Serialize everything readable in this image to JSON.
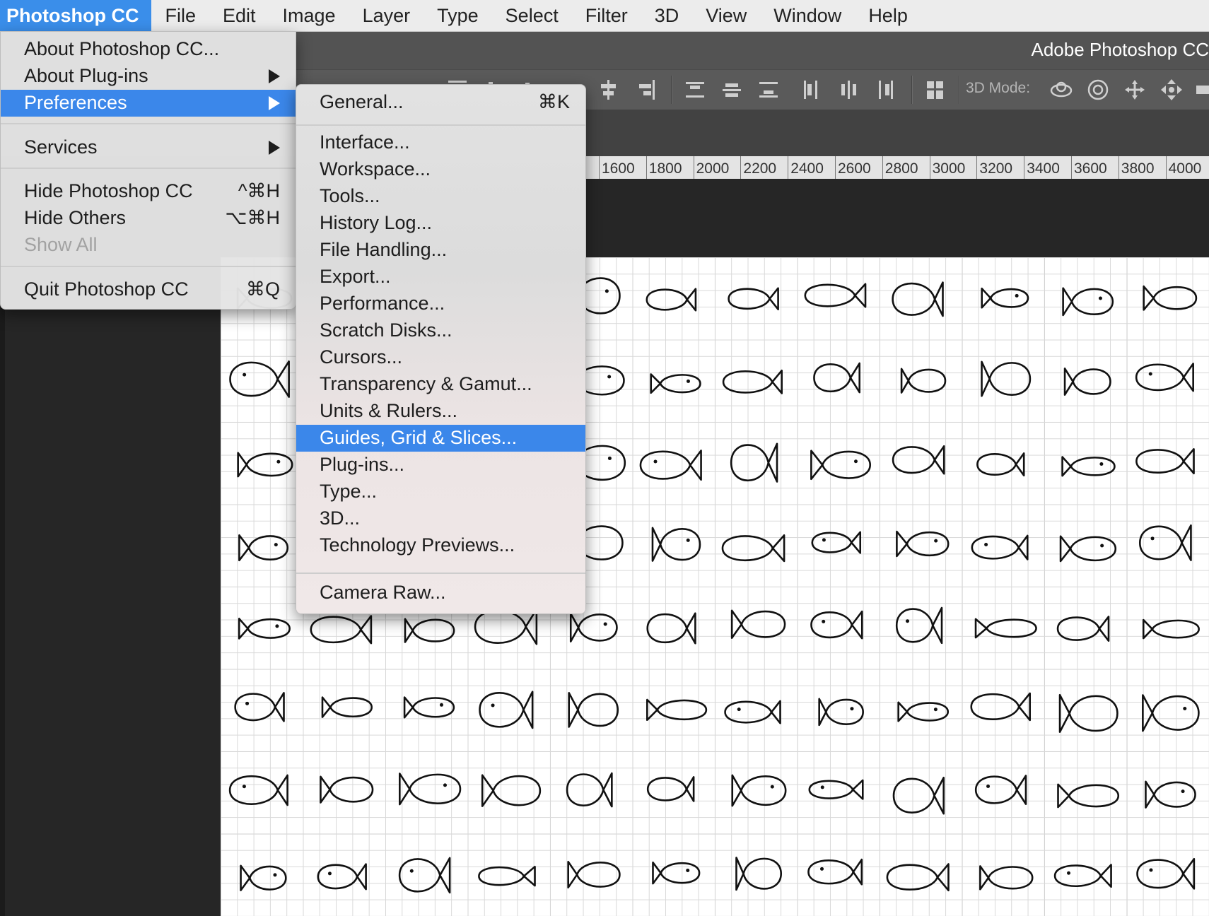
{
  "menubar": {
    "items": [
      "Photoshop CC",
      "File",
      "Edit",
      "Image",
      "Layer",
      "Type",
      "Select",
      "Filter",
      "3D",
      "View",
      "Window",
      "Help"
    ]
  },
  "window": {
    "title": "Adobe Photoshop CC"
  },
  "options_bar": {
    "mode_3d_label": "3D Mode:"
  },
  "ruler": {
    "labels": [
      "1600",
      "1800",
      "2000",
      "2200",
      "2400",
      "2600",
      "2800",
      "3000",
      "3200",
      "3400",
      "3600",
      "3800",
      "4000"
    ]
  },
  "app_menu": {
    "about": "About Photoshop CC...",
    "plugins": "About Plug-ins",
    "preferences": "Preferences",
    "services": "Services",
    "hide": "Hide Photoshop CC",
    "hide_shortcut": "^⌘H",
    "hide_others": "Hide Others",
    "hide_others_shortcut": "⌥⌘H",
    "show_all": "Show All",
    "quit": "Quit Photoshop CC",
    "quit_shortcut": "⌘Q"
  },
  "prefs_menu": {
    "general": "General...",
    "general_shortcut": "⌘K",
    "items": [
      "Interface...",
      "Workspace...",
      "Tools...",
      "History Log...",
      "File Handling...",
      "Export...",
      "Performance...",
      "Scratch Disks...",
      "Cursors...",
      "Transparency & Gamut...",
      "Units & Rulers...",
      "Guides, Grid & Slices...",
      "Plug-ins...",
      "Type...",
      "3D...",
      "Technology Previews..."
    ],
    "selected": "Guides, Grid & Slices...",
    "camera_raw": "Camera Raw..."
  },
  "colors": {
    "accent": "#3b87ea",
    "app_highlight": "#3a8eea"
  }
}
